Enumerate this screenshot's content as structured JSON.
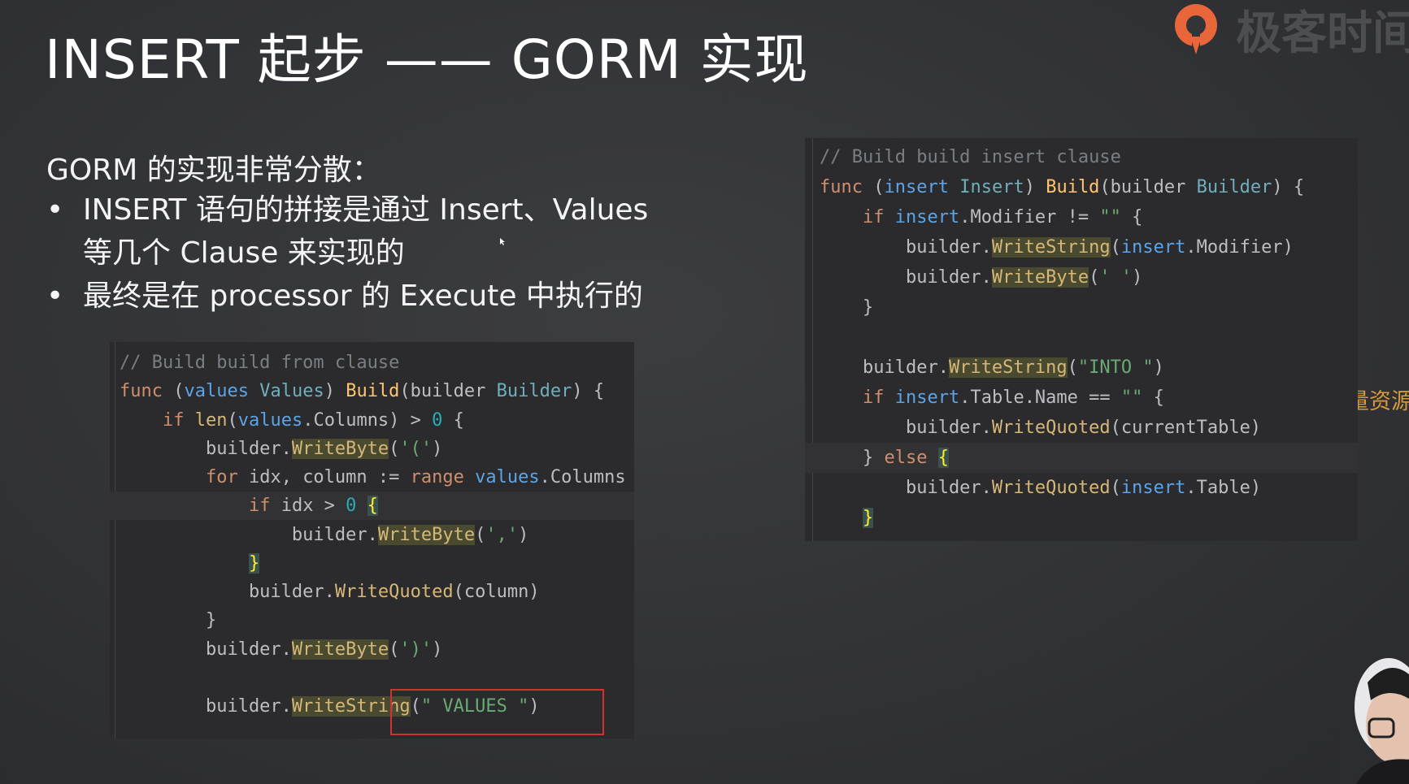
{
  "slide": {
    "title": "INSERT 起步 —— GORM 实现",
    "intro": "GORM 的实现非常分散：",
    "bullets": [
      "INSERT 语句的拼接是通过 Insert、Values 等几个 Clause 来实现的",
      "最终是在 processor 的 Execute 中执行的"
    ],
    "bullet_symbol": "•"
  },
  "branding": {
    "logo_text": "极客时间",
    "logo_color": "#e8663a",
    "watermark": "海量资源"
  },
  "code_left": {
    "lines": [
      "// Build build from clause",
      "func (values Values) Build(builder Builder) {",
      "    if len(values.Columns) > 0 {",
      "        builder.WriteByte('(')",
      "        for idx, column := range values.Columns {",
      "            if idx > 0 {",
      "                builder.WriteByte(',')",
      "            }",
      "            builder.WriteQuoted(column)",
      "        }",
      "        builder.WriteByte(')')",
      "",
      "        builder.WriteString(\" VALUES \")"
    ]
  },
  "code_right": {
    "lines": [
      "// Build build insert clause",
      "func (insert Insert) Build(builder Builder) {",
      "    if insert.Modifier != \"\" {",
      "        builder.WriteString(insert.Modifier)",
      "        builder.WriteByte(' ')",
      "    }",
      "",
      "    builder.WriteString(\"INTO \")",
      "    if insert.Table.Name == \"\" {",
      "        builder.WriteQuoted(currentTable)",
      "    } else {",
      "        builder.WriteQuoted(insert.Table)",
      "    }",
      "}"
    ]
  },
  "colors": {
    "keyword": "#cf8e6d",
    "type": "#6fafbd",
    "function": "#ffc66d",
    "string": "#6aab73",
    "number": "#2aacb8",
    "comment": "#7a7e85",
    "highlight_box": "#d1322f"
  }
}
